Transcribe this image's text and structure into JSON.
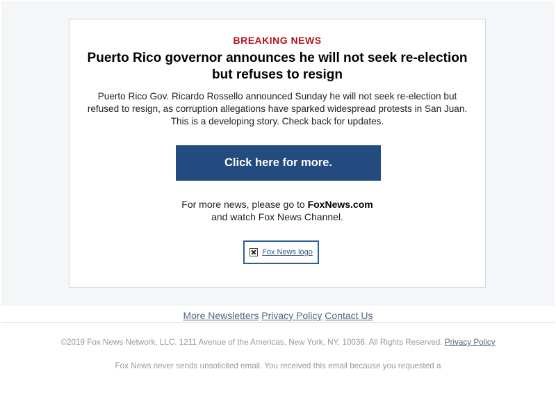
{
  "alert": {
    "label": "BREAKING NEWS",
    "headline_line1": "Puerto Rico governor announces he will not seek re-election",
    "headline_line2": "but refuses to resign",
    "body_line1": "Puerto Rico Gov. Ricardo Rossello announced Sunday he will not seek re-election but",
    "body_line2": "refused to resign, as corruption allegations have sparked widespread protests in San Juan.",
    "body_line3": "This is a developing story. Check back for updates.",
    "cta_label": "Click here for more.",
    "more_news_prefix": "For more news, please go to",
    "more_news_link": "FoxNews.com",
    "more_news_suffix": "and watch Fox News Channel.",
    "logo_alt": "Fox News logo"
  },
  "footer": {
    "links": [
      "More Newsletters",
      "Privacy Policy",
      "Contact Us"
    ],
    "copyright": "©2019 Fox News Network, LLC. 1211 Avenue of the Americas, New York, NY, 10036. All Rights Reserved.",
    "copyright_link": "Privacy Policy",
    "disclaimer": "Fox News never sends unsolicited email. You received this email because you requested a"
  },
  "colors": {
    "breaking_red": "#b5121b",
    "button_blue": "#234b80",
    "link_blue": "#4f6582",
    "card_border": "#cfdbe6",
    "page_bg": "#f5f6f8"
  },
  "icons": {
    "logo": "broken-image-icon"
  }
}
